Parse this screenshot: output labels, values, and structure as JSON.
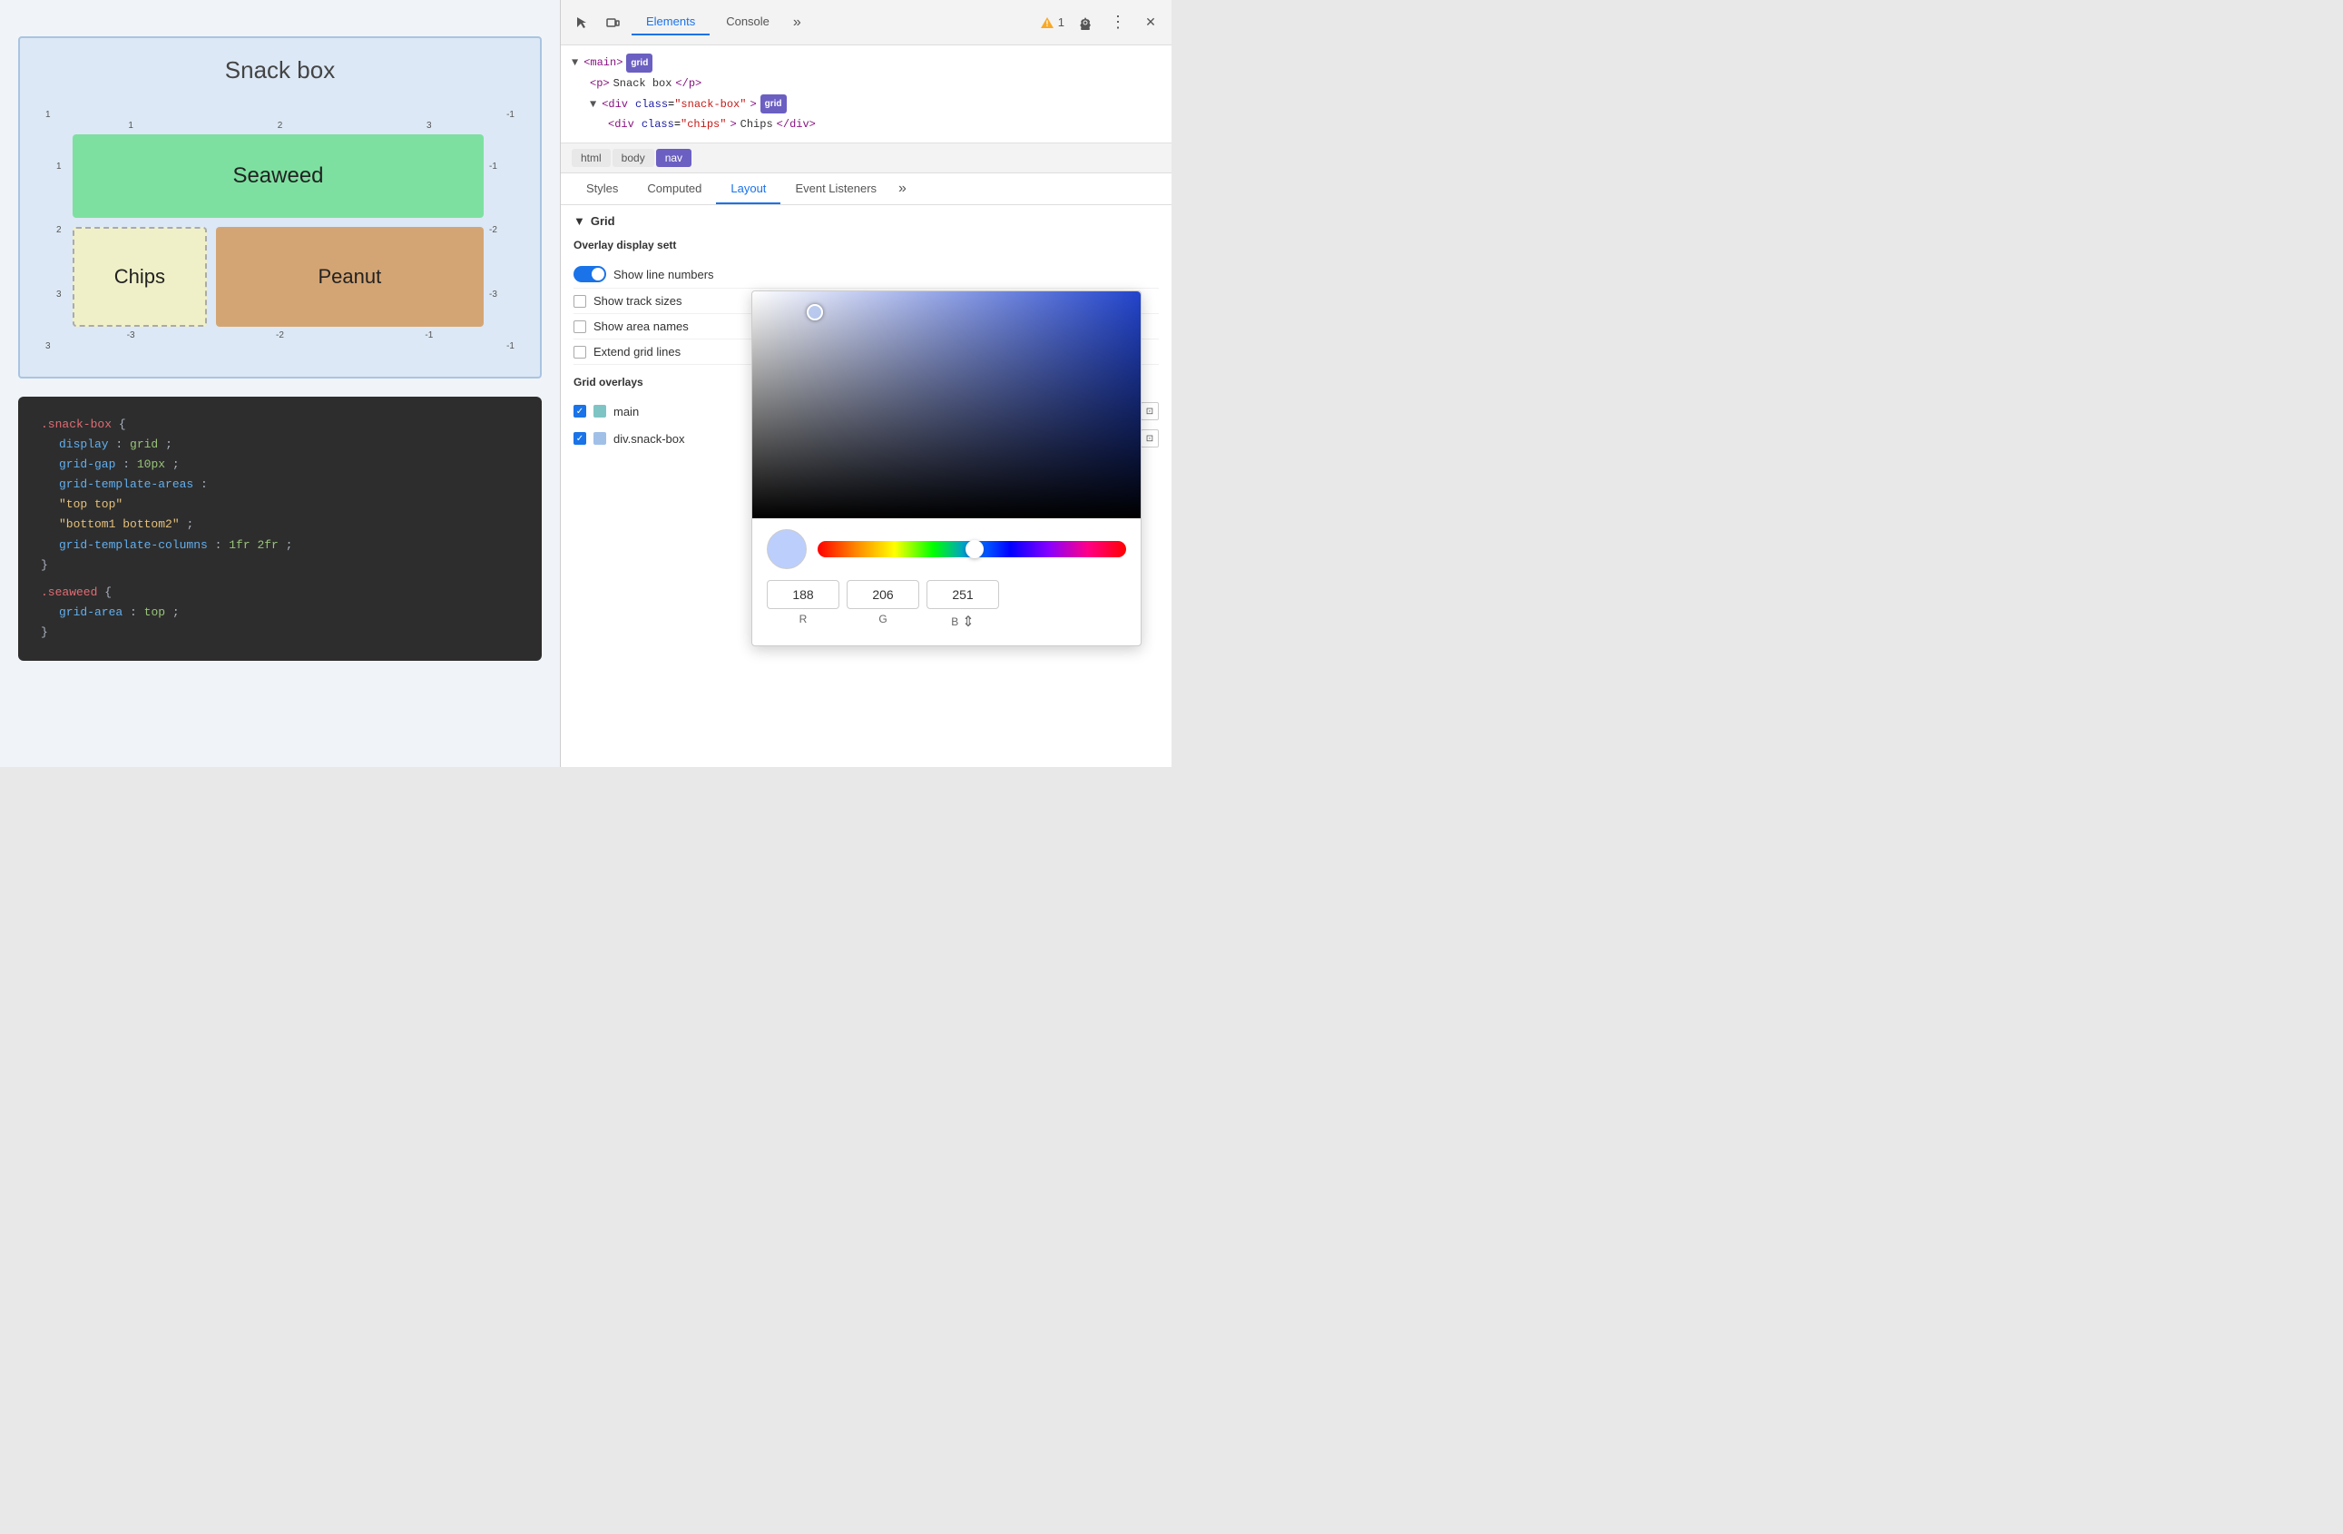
{
  "browser": {
    "title": "Snack box"
  },
  "grid_demo": {
    "title": "Snack box",
    "cells": {
      "seaweed": "Seaweed",
      "chips": "Chips",
      "peanut": "Peanut"
    },
    "grid_numbers": {
      "top": [
        "1",
        "2",
        "3"
      ],
      "left": [
        "1",
        "2",
        "3"
      ],
      "right": [
        "-1",
        "-2",
        "-3"
      ],
      "bottom": [
        "-3",
        "-2",
        "-1"
      ],
      "corners": {
        "tl": "1",
        "tr": "-1",
        "bl": "3",
        "br": "-1"
      }
    }
  },
  "code": {
    "line1": ".snack-box {",
    "line2": "display: grid;",
    "line3": "grid-gap: 10px;",
    "line4": "grid-template-areas:",
    "line5": "\"top top\"",
    "line6": "\"bottom1 bottom2\";",
    "line7": "grid-template-columns: 1fr 2fr;",
    "line8": "}",
    "line9": ".seaweed {",
    "line10": "grid-area: top;",
    "line11": "}"
  },
  "devtools": {
    "tabs": [
      "Elements",
      "Console"
    ],
    "active_tab": "Elements",
    "more_label": "»",
    "warning_count": "1",
    "icons": {
      "cursor": "⬚",
      "device": "⊡",
      "gear": "⚙",
      "more": "⋮",
      "close": "✕"
    },
    "dom_tree": {
      "line1": "▼ <main>",
      "line1_badge": "grid",
      "line2": "<p>Snack box</p>",
      "line3": "▼ <div class=\"snack-box\">",
      "line3_badge": "grid",
      "line4": "<div class=\"chips\">Chips</div>"
    },
    "breadcrumb": [
      "html",
      "body",
      "nav"
    ],
    "panel_tabs": [
      "Styles",
      "Computed",
      "Layout",
      "Event Listeners"
    ],
    "active_panel_tab": "Layout",
    "panel_more": "»",
    "layout": {
      "section_grid": "Grid",
      "overlay_settings_header": "Overlay display sett",
      "settings": [
        {
          "id": "show_line_numbers",
          "label": "Show line numbers",
          "type": "toggle",
          "enabled": true
        },
        {
          "id": "show_track_sizes",
          "label": "Show track sizes",
          "type": "checkbox",
          "checked": false
        },
        {
          "id": "show_area_names",
          "label": "Show area names",
          "type": "checkbox",
          "checked": false
        },
        {
          "id": "extend_grid_lines",
          "label": "Extend grid lines",
          "type": "checkbox",
          "checked": false
        }
      ],
      "overlays_header": "Grid overlays",
      "overlays": [
        {
          "id": "main_overlay",
          "label": "main",
          "color": "#7fc4c4",
          "checked": true
        },
        {
          "id": "snack_box_overlay",
          "label": "div.snack-box",
          "color": "#a0c0e8",
          "checked": true
        }
      ]
    }
  },
  "color_picker": {
    "r": "188",
    "g": "206",
    "b": "251",
    "r_label": "R",
    "g_label": "G",
    "b_label": "B"
  }
}
